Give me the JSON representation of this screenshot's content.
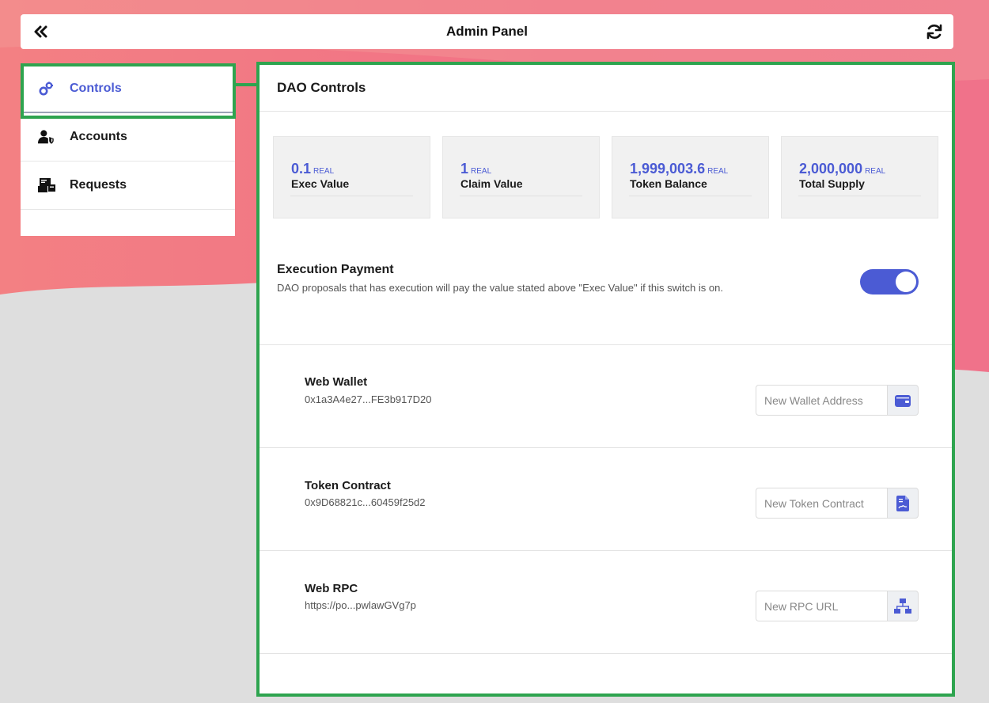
{
  "topbar": {
    "title": "Admin Panel",
    "back_icon": "double-chevron-left-icon",
    "refresh_icon": "refresh-icon"
  },
  "sidebar": {
    "items": [
      {
        "label": "Controls",
        "icon": "cogs-icon",
        "active": true
      },
      {
        "label": "Accounts",
        "icon": "user-shield-icon",
        "active": false
      },
      {
        "label": "Requests",
        "icon": "inbox-request-icon",
        "active": false
      }
    ]
  },
  "panel": {
    "title": "DAO Controls",
    "stats": [
      {
        "value": "0.1",
        "unit": "REAL",
        "label": "Exec Value"
      },
      {
        "value": "1",
        "unit": "REAL",
        "label": "Claim Value"
      },
      {
        "value": "1,999,003.6",
        "unit": "REAL",
        "label": "Token Balance"
      },
      {
        "value": "2,000,000",
        "unit": "REAL",
        "label": "Total Supply"
      }
    ],
    "execution": {
      "title": "Execution Payment",
      "description": "DAO proposals that has execution will pay the value stated above \"Exec Value\" if this switch is on.",
      "enabled": true
    },
    "fields": [
      {
        "name": "Web Wallet",
        "value": "0x1a3A4e27...FE3b917D20",
        "placeholder": "New Wallet Address",
        "icon": "wallet-icon"
      },
      {
        "name": "Token Contract",
        "value": "0x9D68821c...60459f25d2",
        "placeholder": "New Token Contract",
        "icon": "contract-file-icon"
      },
      {
        "name": "Web RPC",
        "value": "https://po...pwlawGVg7p",
        "placeholder": "New RPC URL",
        "icon": "network-icon"
      }
    ]
  },
  "colors": {
    "accent": "#4b5bd4",
    "highlight": "#2ea44f",
    "bg_top": "#f07a85"
  }
}
